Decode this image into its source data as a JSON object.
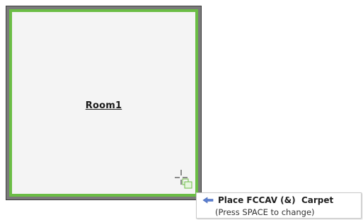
{
  "room": {
    "label": "Room1",
    "wall_color": "#7a7a7a",
    "floor_border_color": "#6bbd45",
    "floor_color": "#f4f4f4"
  },
  "cursor": {
    "icon": "crosshair-place-icon",
    "color": "#6bbd45"
  },
  "tooltip": {
    "icon": "pointer-arrow-icon",
    "icon_color": "#5b7fd1",
    "title": "Place FCCAV (&)  Carpet",
    "hint": "(Press SPACE to change)"
  }
}
